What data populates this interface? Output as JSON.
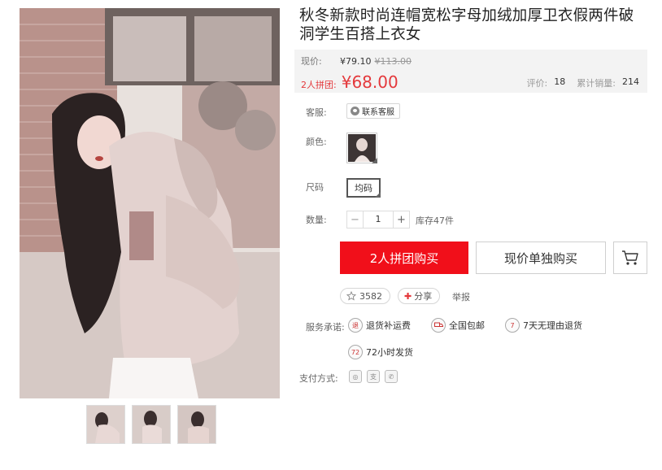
{
  "product": {
    "title": "秋冬新款时尚连帽宽松字母加绒加厚卫衣假两件破洞学生百搭上衣女"
  },
  "price": {
    "current_label": "现价:",
    "current_value": "¥79.10",
    "original_value": "¥113.00",
    "group_label": "2人拼团:",
    "group_value": "¥68.00",
    "rating_label": "评价:",
    "rating_value": "18",
    "sales_label": "累计销量:",
    "sales_value": "214"
  },
  "options": {
    "service_label": "客服:",
    "service_button": "联系客服",
    "color_label": "颜色:",
    "size_label": "尺码",
    "size_value": "均码",
    "qty_label": "数量:",
    "qty_minus": "−",
    "qty_value": "1",
    "qty_plus": "+",
    "stock_text": "库存47件"
  },
  "actions": {
    "group_buy": "2人拼团购买",
    "solo_buy": "现价单独购买",
    "fav_count": "3582",
    "share_label": "分享",
    "report_label": "举报"
  },
  "services": {
    "label": "服务承诺:",
    "items": [
      "退货补运费",
      "全国包邮",
      "7天无理由退货",
      "72小时发货"
    ],
    "icon_text": [
      "退",
      "",
      "7",
      "72"
    ]
  },
  "payment": {
    "label": "支付方式:"
  },
  "icons": {
    "service": "chat-bubble-icon",
    "cart": "shopping-cart-icon",
    "fav": "star-outline-icon",
    "share": "plus-icon",
    "pay": [
      "alipay-style-icon",
      "yi-wallet-icon",
      "wechat-pay-icon"
    ]
  },
  "colors": {
    "accent": "#f10f1a",
    "price_red": "#e4393c",
    "price_bg": "#f3f3f3"
  }
}
